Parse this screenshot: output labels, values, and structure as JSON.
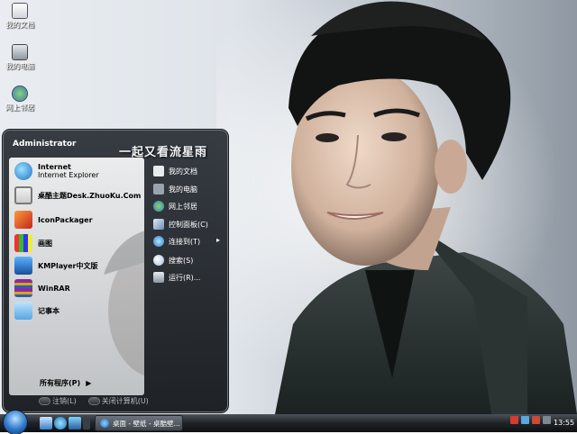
{
  "desktop_icons": [
    {
      "label": "我的文档",
      "icon": "my-documents-icon"
    },
    {
      "label": "我的电脑",
      "icon": "my-computer-icon"
    },
    {
      "label": "网上邻居",
      "icon": "network-places-icon"
    }
  ],
  "start_menu": {
    "user": "Administrator",
    "banner": "一起又看流星雨",
    "programs": [
      {
        "title": "Internet",
        "subtitle": "Internet Explorer",
        "icon": "internet-explorer-icon"
      },
      {
        "title": "桌酷主题Desk.ZhuoKu.Com",
        "icon": "zhuoku-theme-icon"
      },
      {
        "title": "IconPackager",
        "icon": "iconpackager-icon"
      },
      {
        "title": "画图",
        "icon": "paint-icon"
      },
      {
        "title": "KMPlayer中文版",
        "icon": "kmplayer-icon"
      },
      {
        "title": "WinRAR",
        "icon": "winrar-icon"
      },
      {
        "title": "记事本",
        "icon": "notepad-icon"
      }
    ],
    "all_programs": "所有程序(P)",
    "places": [
      {
        "label": "我的文档",
        "icon": "my-documents-icon"
      },
      {
        "label": "我的电脑",
        "icon": "my-computer-icon"
      },
      {
        "label": "网上邻居",
        "icon": "network-places-icon"
      },
      {
        "label": "控制面板(C)",
        "icon": "control-panel-icon"
      },
      {
        "label": "连接到(T)",
        "icon": "connect-to-icon"
      },
      {
        "label": "搜索(S)",
        "icon": "search-icon"
      },
      {
        "label": "运行(R)...",
        "icon": "run-icon"
      }
    ],
    "logoff": "注销(L)",
    "shutdown": "关闭计算机(U)"
  },
  "taskbar": {
    "task_button": "桌面 - 壁纸 - 桌酷壁...",
    "clock": "13:55"
  },
  "colors": {
    "menu_dark": "#1c2026",
    "taskbar": "#1f2328",
    "accent_blue": "#2d78c8"
  }
}
